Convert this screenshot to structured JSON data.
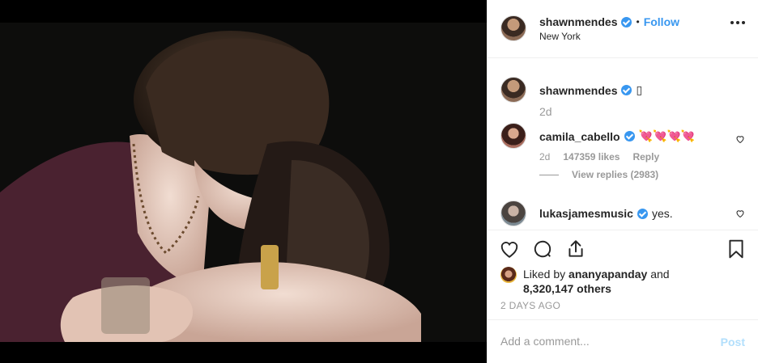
{
  "post": {
    "author": "shawnmendes",
    "follow_label": "Follow",
    "separator": "•",
    "location": "New York"
  },
  "caption": {
    "author": "shawnmendes",
    "text": "▯",
    "time": "2d"
  },
  "comments": [
    {
      "author": "camila_cabello",
      "text": "💘💘💘💘",
      "time": "2d",
      "likes": "147359 likes",
      "reply_label": "Reply",
      "view_replies": "View replies (2983)"
    },
    {
      "author": "lukasjamesmusic",
      "text": "yes."
    }
  ],
  "likes": {
    "prefix": "Liked by ",
    "user": "ananyapanday",
    "and": " and",
    "count": "8,320,147 others"
  },
  "timestamp": "2 DAYS AGO",
  "add_comment": {
    "placeholder": "Add a comment...",
    "post_label": "Post"
  },
  "colors": {
    "accent": "#3897f0",
    "post_disabled": "#b2dffc",
    "muted": "#999999"
  },
  "icons": [
    "heart-icon",
    "comment-icon",
    "share-icon",
    "bookmark-icon",
    "more-options-icon",
    "verified-badge-icon"
  ]
}
